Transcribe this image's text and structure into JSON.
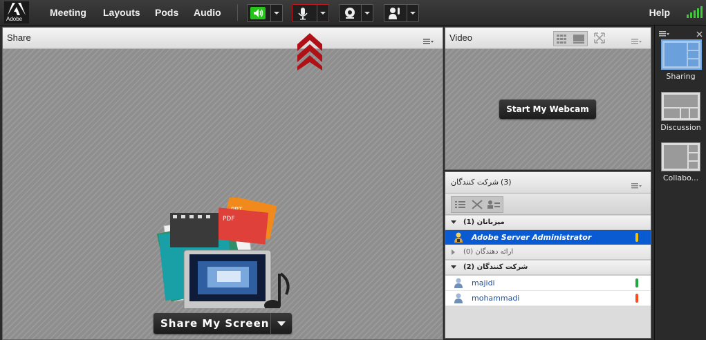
{
  "brand": {
    "logo_text": "Adobe"
  },
  "menu": {
    "meeting": "Meeting",
    "layouts": "Layouts",
    "pods": "Pods",
    "audio": "Audio",
    "help": "Help"
  },
  "share_pod": {
    "title": "Share",
    "share_button": "Share My Screen"
  },
  "video_pod": {
    "title": "Video",
    "webcam_button": "Start My Webcam"
  },
  "attendees_pod": {
    "title": "شرکت کنندگان",
    "count": "(3)",
    "sections": [
      {
        "label": "(1) میزبانان",
        "rows": [
          {
            "name": "Adobe Server Administrator",
            "status_color": "#f5c200"
          }
        ]
      },
      {
        "label": "(0) ارائه دهندگان",
        "rows": []
      },
      {
        "label": "(2) شرکت کنندگان",
        "rows": [
          {
            "name": "majidi",
            "status_color": "#1fa83c"
          },
          {
            "name": "mohammadi",
            "status_color": "#ff4a1c"
          }
        ]
      }
    ]
  },
  "layouts_rail": {
    "items": [
      "Sharing",
      "Discussion",
      "Collabo..."
    ]
  },
  "doc_labels": {
    "ppt": "PPT",
    "pdf": "PDF"
  },
  "colors": {
    "accent": "#0a5bd1",
    "speaker_on": "#27c41c",
    "mic_highlight": "#c2161b"
  }
}
